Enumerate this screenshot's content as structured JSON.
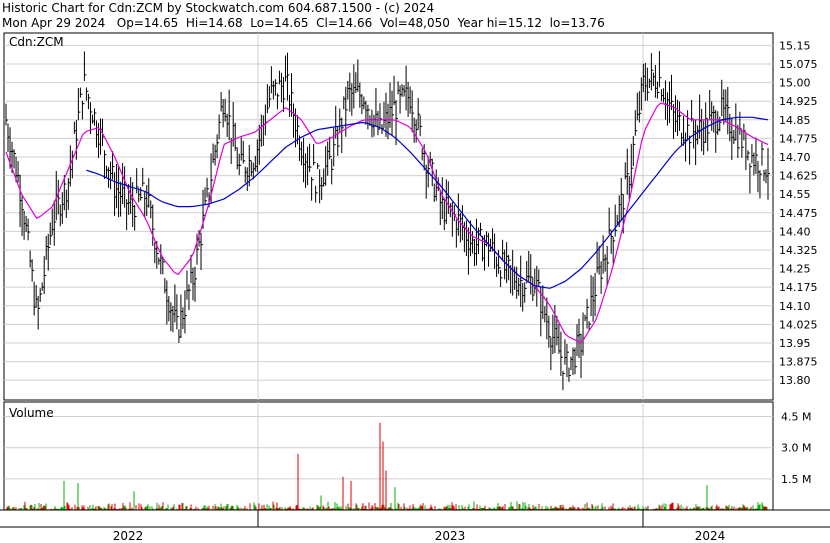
{
  "header": {
    "line1": "Historic Chart for Cdn:ZCM by Stockwatch.com 604.687.1500 - (c) 2024",
    "line2": "Mon Apr 29 2024   Op=14.65  Hi=14.68  Lo=14.65  Cl=14.66  Vol=48,050  Year hi=15.12  lo=13.76"
  },
  "chart_data": [
    {
      "type": "ohlc",
      "symbol_label": "Cdn:ZCM",
      "ylim": [
        13.72,
        15.2
      ],
      "y_ticks": [
        "15.15",
        "15.075",
        "15.00",
        "14.925",
        "14.85",
        "14.775",
        "14.70",
        "14.625",
        "14.55",
        "14.475",
        "14.40",
        "14.325",
        "14.25",
        "14.175",
        "14.10",
        "14.025",
        "13.95",
        "13.875",
        "13.80"
      ],
      "x_labels": [
        "2022",
        "2023",
        "2024"
      ],
      "price_path_close": [
        14.85,
        14.55,
        14.05,
        14.45,
        14.6,
        15.0,
        14.8,
        14.58,
        14.5,
        14.55,
        14.25,
        14.0,
        14.2,
        14.55,
        14.95,
        14.65,
        14.7,
        14.95,
        15.0,
        14.75,
        14.6,
        14.7,
        14.95,
        14.95,
        14.8,
        14.9,
        14.95,
        14.7,
        14.5,
        14.45,
        14.35,
        14.35,
        14.25,
        14.2,
        14.2,
        14.0,
        13.85,
        13.95,
        14.2,
        14.4,
        14.6,
        15.0,
        15.02,
        14.85,
        14.8,
        14.82,
        14.88,
        14.8,
        14.7,
        14.66
      ],
      "moving_averages": [
        {
          "color": "#e000e0",
          "values": [
            14.72,
            14.55,
            14.45,
            14.5,
            14.65,
            14.8,
            14.82,
            14.7,
            14.55,
            14.45,
            14.3,
            14.22,
            14.3,
            14.5,
            14.75,
            14.78,
            14.8,
            14.85,
            14.9,
            14.85,
            14.75,
            14.78,
            14.82,
            14.85,
            14.85,
            14.85,
            14.82,
            14.72,
            14.55,
            14.45,
            14.38,
            14.35,
            14.28,
            14.22,
            14.18,
            14.1,
            13.98,
            13.95,
            14.05,
            14.25,
            14.5,
            14.8,
            14.92,
            14.9,
            14.85,
            14.85,
            14.85,
            14.82,
            14.78,
            14.75
          ]
        },
        {
          "color": "#0000d0",
          "values": [
            null,
            null,
            null,
            null,
            null,
            14.65,
            14.63,
            14.6,
            14.58,
            14.56,
            14.52,
            14.5,
            14.5,
            14.51,
            14.53,
            14.57,
            14.62,
            14.68,
            14.74,
            14.78,
            14.81,
            14.82,
            14.83,
            14.84,
            14.82,
            14.78,
            14.72,
            14.65,
            14.58,
            14.5,
            14.42,
            14.35,
            14.28,
            14.22,
            14.18,
            14.17,
            14.2,
            14.25,
            14.32,
            14.4,
            14.48,
            14.56,
            14.64,
            14.72,
            14.78,
            14.82,
            14.85,
            14.86,
            14.86,
            14.85
          ]
        }
      ]
    },
    {
      "type": "bar",
      "title": "Volume",
      "ylim": [
        0,
        5200000
      ],
      "y_ticks": [
        "4.5 M",
        "3.0 M",
        "1.5 M"
      ],
      "up_color": "#00b000",
      "down_color": "#e00000",
      "spikes": [
        {
          "index": 64,
          "value": 1400000,
          "color": "up"
        },
        {
          "index": 78,
          "value": 1300000,
          "color": "up"
        },
        {
          "index": 134,
          "value": 900000,
          "color": "up"
        },
        {
          "index": 298,
          "value": 2700000,
          "color": "down"
        },
        {
          "index": 321,
          "value": 700000,
          "color": "up"
        },
        {
          "index": 343,
          "value": 1600000,
          "color": "down"
        },
        {
          "index": 351,
          "value": 1400000,
          "color": "down"
        },
        {
          "index": 380,
          "value": 4200000,
          "color": "down"
        },
        {
          "index": 383,
          "value": 3300000,
          "color": "down"
        },
        {
          "index": 386,
          "value": 1900000,
          "color": "down"
        },
        {
          "index": 395,
          "value": 1100000,
          "color": "up"
        },
        {
          "index": 707,
          "value": 1200000,
          "color": "up"
        }
      ]
    }
  ]
}
